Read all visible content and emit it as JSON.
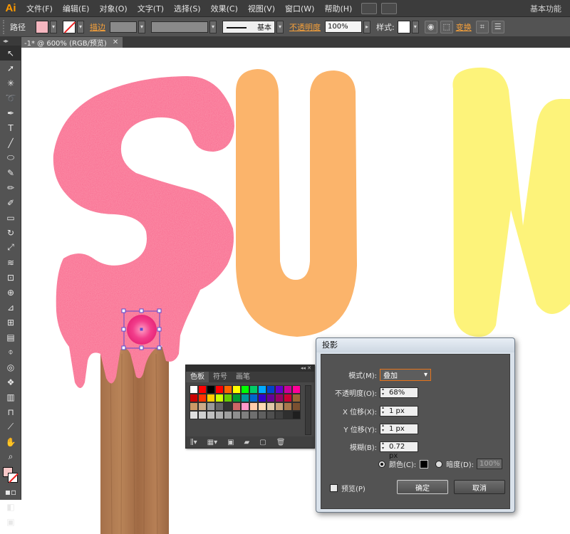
{
  "menubar": {
    "logo": "Ai",
    "items": [
      "文件(F)",
      "编辑(E)",
      "对象(O)",
      "文字(T)",
      "选择(S)",
      "效果(C)",
      "视图(V)",
      "窗口(W)",
      "帮助(H)"
    ],
    "workspace": "基本功能"
  },
  "controlbar": {
    "object_type": "路径",
    "stroke_label": "描边",
    "stroke_style": "基本",
    "opacity_label": "不透明度",
    "opacity_value": "100%",
    "style_label": "样式:",
    "transform_label": "变换"
  },
  "document": {
    "tab_title": "-1* @ 600% (RGB/预览)"
  },
  "tools": [
    "selection-tool",
    "direct-selection-tool",
    "magic-wand-tool",
    "lasso-tool",
    "pen-tool",
    "type-tool",
    "line-tool",
    "ellipse-tool",
    "paintbrush-tool",
    "pencil-tool",
    "blob-brush-tool",
    "eraser-tool",
    "rotate-tool",
    "scale-tool",
    "warp-tool",
    "free-transform-tool",
    "shape-builder-tool",
    "perspective-tool",
    "mesh-tool",
    "gradient-tool",
    "eyedropper-tool",
    "blend-tool",
    "symbol-sprayer-tool",
    "column-graph-tool",
    "artboard-tool",
    "slice-tool",
    "hand-tool",
    "zoom-tool"
  ],
  "canvas": {
    "letters": [
      "S",
      "U",
      "N"
    ],
    "colors": {
      "s_pink": "#f9678f",
      "u_orange": "#fbb46b",
      "n_yellow": "#fdf37a",
      "stick": "#b07a52"
    }
  },
  "swatches_panel": {
    "tabs": [
      "色板",
      "符号",
      "画笔"
    ],
    "swatch_colors": [
      "#ffffff",
      "#ff0000",
      "#000000",
      "#ff0000",
      "#ff6600",
      "#ffff00",
      "#00ff00",
      "#00cc66",
      "#00aaff",
      "#0044cc",
      "#6600cc",
      "#cc0099",
      "#ff0099",
      "#cc0000",
      "#ff3300",
      "#ffcc00",
      "#ccff00",
      "#66cc00",
      "#009933",
      "#009999",
      "#0066cc",
      "#3300cc",
      "#660099",
      "#990066",
      "#cc0033",
      "#996633",
      "#cc9966",
      "#ccaa88",
      "#999999",
      "#666666",
      "#333333",
      "#cc6666",
      "#ff99cc",
      "#ffccaa",
      "#ffd9b3",
      "#e0c8a8",
      "#c8a27a",
      "#a8784c",
      "#7a5030",
      "#e0e0e0",
      "#cfcfcf",
      "#bfbfbf",
      "#afafaf",
      "#9f9f9f",
      "#8f8f8f",
      "#7f7f7f",
      "#6f6f6f",
      "#5f5f5f",
      "#4f4f4f",
      "#3f3f3f",
      "#2f2f2f",
      "#1f1f1f"
    ]
  },
  "dialog": {
    "title": "投影",
    "mode_label": "模式(M):",
    "mode_value": "叠加",
    "opacity_label": "不透明度(O):",
    "opacity_value": "68%",
    "x_label": "X 位移(X):",
    "x_value": "1 px",
    "y_label": "Y 位移(Y):",
    "y_value": "1 px",
    "blur_label": "模糊(B):",
    "blur_value": "0.72 px",
    "color_label": "颜色(C):",
    "darkness_label": "暗度(D):",
    "darkness_value": "100%",
    "preview_label": "预览(P)",
    "ok_label": "确定",
    "cancel_label": "取消"
  }
}
